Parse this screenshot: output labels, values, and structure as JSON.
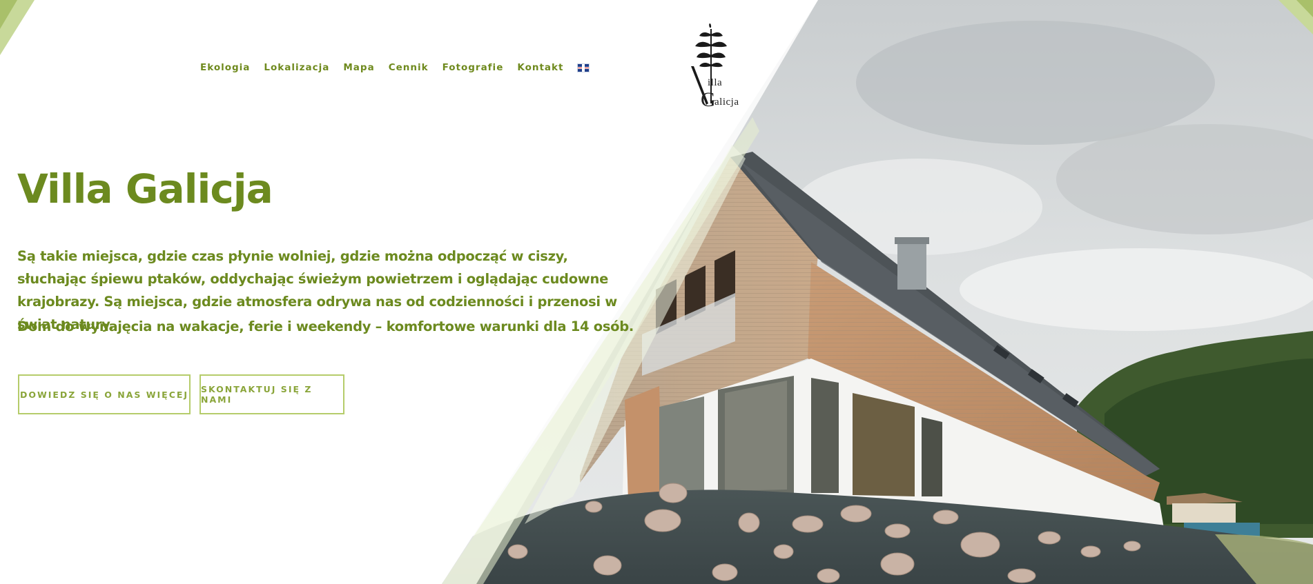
{
  "nav": {
    "items": [
      {
        "label": "Ekologia"
      },
      {
        "label": "Lokalizacja"
      },
      {
        "label": "Mapa"
      },
      {
        "label": "Cennik"
      },
      {
        "label": "Fotografie"
      },
      {
        "label": "Kontakt"
      }
    ],
    "language_icon": "uk-flag-icon"
  },
  "logo": {
    "line1": "illa",
    "line1_initial": "V",
    "line2": "alicja",
    "line2_initial": "G",
    "icon": "tree-icon"
  },
  "hero": {
    "title": "Villa Galicja",
    "description": "Są takie miejsca, gdzie czas płynie wolniej, gdzie można odpocząć w ciszy, słuchając śpiewu ptaków, oddychając świeżym powietrzem i oglądając cudowne krajobrazy. Są miejsca, gdzie atmosfera odrywa nas od codzienności i przenosi w świat natury.",
    "subtitle": "Dom do wynajęcia na wakacje, ferie i weekendy – komfortowe warunki dla 14 osób.",
    "button_more": "DOWIEDZ SIĘ O NAS WIĘCEJ",
    "button_contact": "SKONTAKTUJ SIĘ Z NAMI"
  },
  "colors": {
    "accent": "#6c8a1f",
    "button_border": "#b5cc6a",
    "background": "#ffffff"
  }
}
